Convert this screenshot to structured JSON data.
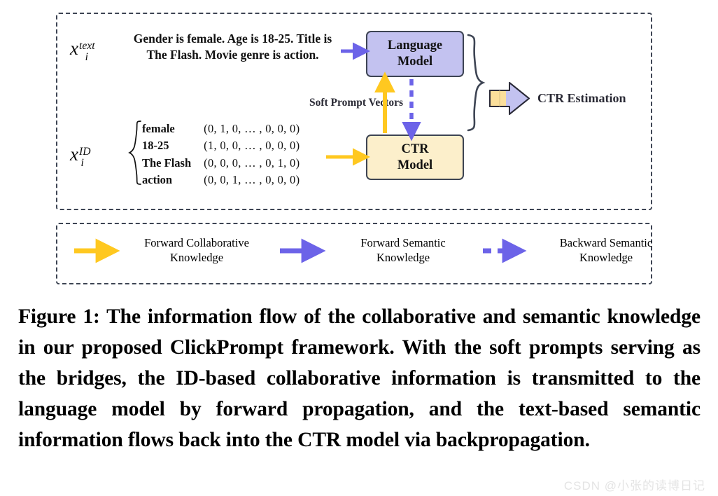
{
  "figure": {
    "main_box": {
      "name": "main-diagram-region"
    },
    "inputs": {
      "text_symbol_base": "x",
      "text_symbol_sup": "text",
      "text_symbol_sub": "i",
      "prompt_sentence": "Gender is female. Age is 18-25. Title is The Flash. Movie genre is action.",
      "id_symbol_base": "x",
      "id_symbol_sup": "ID",
      "id_symbol_sub": "i",
      "id_features": [
        {
          "name": "female",
          "vector": "(0, 1, 0, … , 0, 0, 0)"
        },
        {
          "name": "18-25",
          "vector": "(1, 0, 0, … , 0, 0, 0)"
        },
        {
          "name": "The Flash",
          "vector": "(0, 0, 0, … , 0, 1, 0)"
        },
        {
          "name": "action",
          "vector": "(0, 0, 1, … , 0, 0, 0)"
        }
      ]
    },
    "blocks": {
      "language_model_line1": "Language",
      "language_model_line2": "Model",
      "ctr_model_line1": "CTR",
      "ctr_model_line2": "Model"
    },
    "labels": {
      "soft_prompt_vectors": "Soft Prompt Vectors",
      "ctr_estimation": "CTR Estimation"
    },
    "legend": [
      {
        "arrow": "solid-yellow-arrow-icon",
        "line1": "Forward Collaborative",
        "line2": "Knowledge"
      },
      {
        "arrow": "solid-purple-arrow-icon",
        "line1": "Forward Semantic",
        "line2": "Knowledge"
      },
      {
        "arrow": "dashed-purple-arrow-icon",
        "line1": "Backward Semantic",
        "line2": "Knowledge"
      }
    ],
    "colors": {
      "yellow": "#FFC820",
      "purple": "#6C63E8",
      "language_model_fill": "#C3C2F0",
      "ctr_model_fill": "#FCEFCB",
      "outline": "#3D4453"
    }
  },
  "caption": {
    "text": "Figure 1: The information flow of the collaborative and semantic knowledge in our proposed ClickPrompt framework. With the soft prompts serving as the bridges, the ID-based collaborative information is transmitted to the language model by forward propagation, and the text-based semantic information flows back into the CTR model via backpropagation."
  },
  "watermark": {
    "text": "CSDN @小张的读博日记"
  }
}
